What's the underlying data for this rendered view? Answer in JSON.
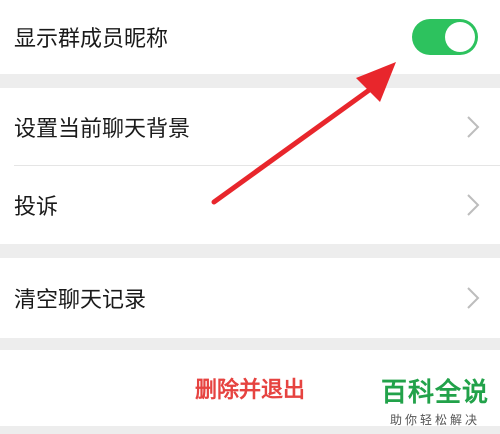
{
  "settings": {
    "show_nickname_label": "显示群成员昵称",
    "set_background_label": "设置当前聊天背景",
    "complain_label": "投诉",
    "clear_history_label": "清空聊天记录",
    "delete_exit_label": "删除并退出",
    "show_nickname_enabled": true
  },
  "watermark": {
    "title": "百科全说",
    "subtitle": "助你轻松解决"
  },
  "colors": {
    "toggle_on": "#2dc25e",
    "danger_text": "#e64340",
    "chevron": "#bdbdbd",
    "annotation_arrow": "#e8262c"
  },
  "icons": {
    "chevron": "chevron-right-icon",
    "annotation": "arrow-annotation"
  }
}
